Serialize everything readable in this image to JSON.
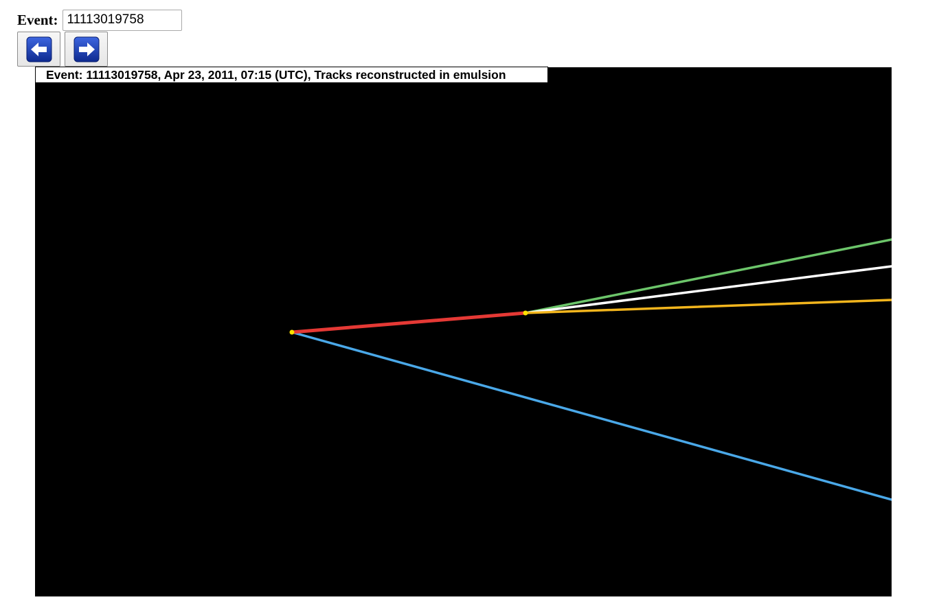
{
  "form": {
    "event_label": "Event:",
    "event_value": "11113019758"
  },
  "nav": {
    "prev_icon": "left-arrow-icon",
    "next_icon": "right-arrow-icon",
    "button_color": "#1a3eb0"
  },
  "viewer": {
    "caption": "Event: 11113019758, Apr 23, 2011, 07:15 (UTC), Tracks reconstructed in emulsion",
    "background": "#000000",
    "track_colors": {
      "primary": "#e53935",
      "green": "#6cc56a",
      "white": "#ffffff",
      "yellow": "#f2b51d",
      "blue": "#4aa8e8",
      "vertex": "#ffe000"
    }
  }
}
